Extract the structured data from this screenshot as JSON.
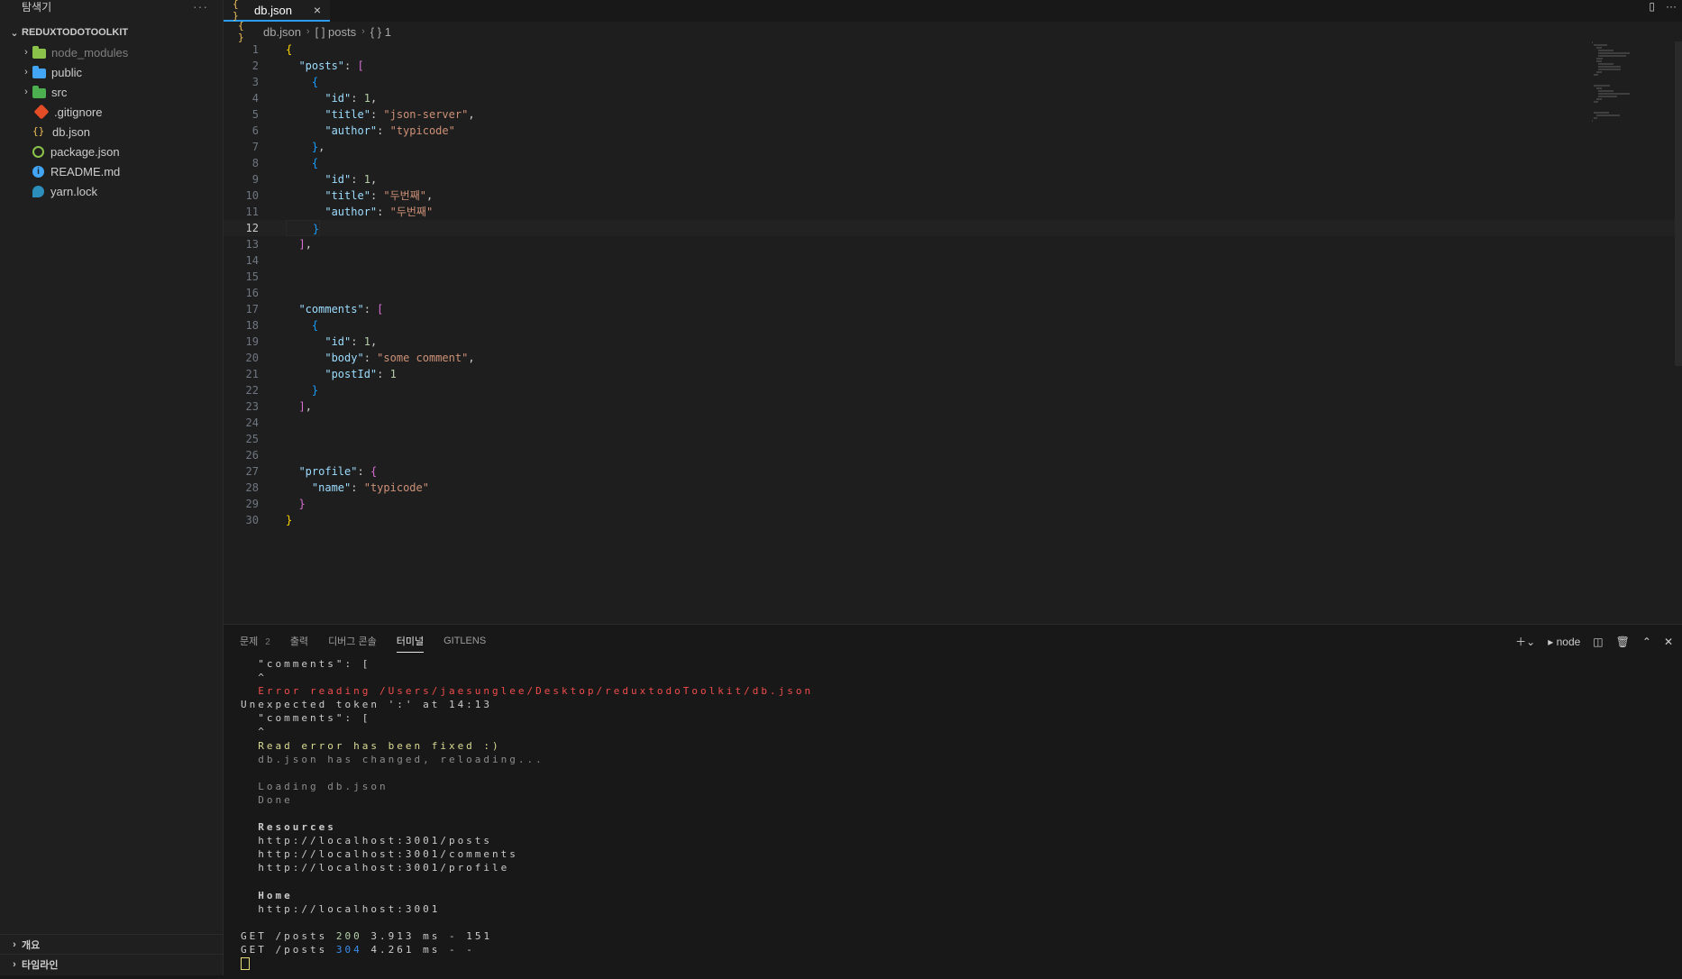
{
  "sidebar": {
    "title": "탐색기",
    "more": "···",
    "project": "REDUXTODOTOOLKIT",
    "items": [
      {
        "label": "node_modules",
        "type": "folder",
        "color": "#8bc34a"
      },
      {
        "label": "public",
        "type": "folder",
        "color": "#42a5f5"
      },
      {
        "label": "src",
        "type": "folder",
        "color": "#4caf50"
      },
      {
        "label": ".gitignore",
        "type": "file",
        "icon": "git-icon"
      },
      {
        "label": "db.json",
        "type": "file",
        "icon": "json-icon"
      },
      {
        "label": "package.json",
        "type": "file",
        "icon": "package-icon"
      },
      {
        "label": "README.md",
        "type": "file",
        "icon": "info-icon"
      },
      {
        "label": "yarn.lock",
        "type": "file",
        "icon": "yarn-icon"
      }
    ],
    "outline": "개요",
    "timeline": "타임라인"
  },
  "editor": {
    "tab": {
      "icon": "{ }",
      "label": "db.json",
      "close": "×"
    },
    "breadcrumb": {
      "file_icon": "{ }",
      "file": "db.json",
      "seg2": "[ ] posts",
      "seg3": "{ } 1"
    },
    "current_line": 12,
    "lines": [
      "{",
      "  \"posts\": [",
      "    {",
      "      \"id\": 1,",
      "      \"title\": \"json-server\",",
      "      \"author\": \"typicode\"",
      "    },",
      "    {",
      "      \"id\": 1,",
      "      \"title\": \"두번째\",",
      "      \"author\": \"두번째\"",
      "    }",
      "  ],",
      "",
      "",
      "",
      "  \"comments\": [",
      "    {",
      "      \"id\": 1,",
      "      \"body\": \"some comment\",",
      "      \"postId\": 1",
      "    }",
      "  ],",
      "",
      "",
      "",
      "  \"profile\": {",
      "    \"name\": \"typicode\"",
      "  }",
      "}"
    ]
  },
  "panel": {
    "tabs": [
      {
        "label": "문제",
        "badge": "2"
      },
      {
        "label": "출력"
      },
      {
        "label": "디버그 콘솔"
      },
      {
        "label": "터미널",
        "active": true
      },
      {
        "label": "GITLENS"
      }
    ],
    "terminal_name": "node",
    "terminal_lines": [
      {
        "text": "  \"comments\": [",
        "style": ""
      },
      {
        "text": "  ^",
        "style": ""
      },
      {
        "text": "  Error reading /Users/jaesunglee/Desktop/reduxtodoToolkit/db.json",
        "style": "t-red"
      },
      {
        "text": "Unexpected token ':' at 14:13",
        "style": ""
      },
      {
        "text": "  \"comments\": [",
        "style": ""
      },
      {
        "text": "  ^",
        "style": ""
      },
      {
        "text": "  Read error has been fixed :)",
        "style": "t-yel"
      },
      {
        "text": "  db.json has changed, reloading...",
        "style": "t-dim"
      },
      {
        "text": "",
        "style": ""
      },
      {
        "text": "  Loading db.json",
        "style": "t-dim"
      },
      {
        "text": "  Done",
        "style": "t-dim"
      },
      {
        "text": "",
        "style": ""
      },
      {
        "text": "  Resources",
        "style": "t-bold"
      },
      {
        "text": "  http://localhost:3001/posts",
        "style": ""
      },
      {
        "text": "  http://localhost:3001/comments",
        "style": ""
      },
      {
        "text": "  http://localhost:3001/profile",
        "style": ""
      },
      {
        "text": "",
        "style": ""
      },
      {
        "text": "  Home",
        "style": "t-bold"
      },
      {
        "text": "  http://localhost:3001",
        "style": ""
      },
      {
        "text": "",
        "style": ""
      }
    ],
    "requests": [
      {
        "method": "GET /posts ",
        "status": "200",
        "status_style": "t-green",
        "rest": " 3.913 ms - 151"
      },
      {
        "method": "GET /posts ",
        "status": "304",
        "status_style": "t-blue",
        "rest": " 4.261 ms - -"
      }
    ]
  },
  "colors": {
    "accent": "#2b9cf0",
    "background": "#1e1e1e",
    "error": "#f14c4c"
  }
}
